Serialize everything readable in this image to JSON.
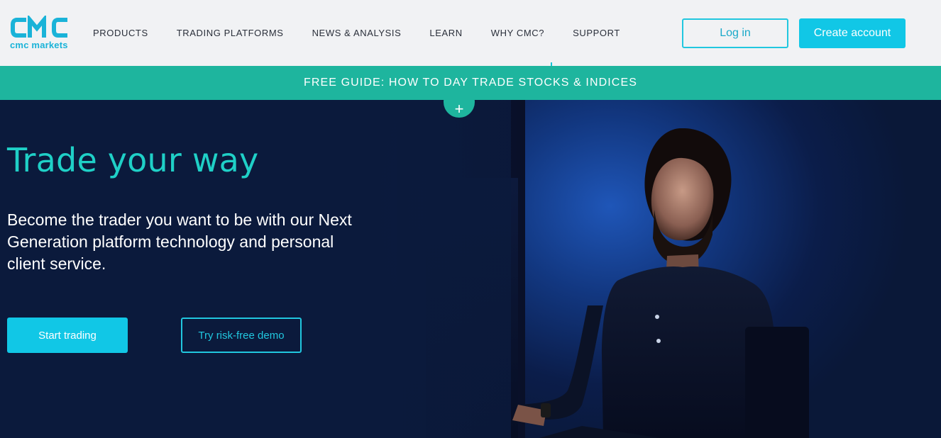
{
  "header": {
    "logo_text": "cmc markets",
    "nav": [
      {
        "label": "PRODUCTS"
      },
      {
        "label": "TRADING PLATFORMS"
      },
      {
        "label": "NEWS & ANALYSIS"
      },
      {
        "label": "LEARN"
      },
      {
        "label": "WHY CMC?"
      },
      {
        "label": "SUPPORT"
      }
    ],
    "login_label": "Log in",
    "create_account_label": "Create account"
  },
  "banner": {
    "text": "FREE GUIDE: HOW TO DAY TRADE STOCKS & INDICES",
    "plus_icon": "plus-icon",
    "plus_glyph": "+"
  },
  "hero": {
    "title": "Trade your way",
    "subtitle": "Become the trader you want to be with our Next Generation platform technology and personal client service.",
    "start_label": "Start trading",
    "demo_label": "Try risk-free demo"
  },
  "colors": {
    "accent": "#11c7e6",
    "banner": "#1eb59e",
    "hero_title": "#1fd0c7",
    "hero_bg": "#0b1a3c"
  }
}
